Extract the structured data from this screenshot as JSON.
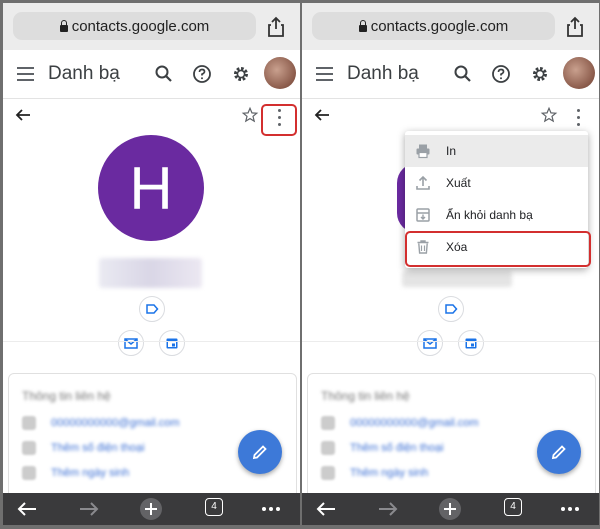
{
  "browser": {
    "url": "contacts.google.com",
    "tab_count": "4"
  },
  "app": {
    "title": "Danh bạ"
  },
  "contact": {
    "initial": "H"
  },
  "card": {
    "title": "Thông tin liên hệ",
    "rows": [
      "00000000000@gmail.com",
      "Thêm số điện thoại",
      "Thêm ngày sinh"
    ]
  },
  "menu": {
    "items": [
      {
        "label": "In",
        "icon": "print-icon"
      },
      {
        "label": "Xuất",
        "icon": "export-icon"
      },
      {
        "label": "Ẩn khỏi danh bạ",
        "icon": "archive-icon"
      },
      {
        "label": "Xóa",
        "icon": "trash-icon"
      }
    ]
  },
  "colors": {
    "avatar": "#6a2aa0",
    "fab": "#3d79d8",
    "highlight": "#d32f2f"
  }
}
